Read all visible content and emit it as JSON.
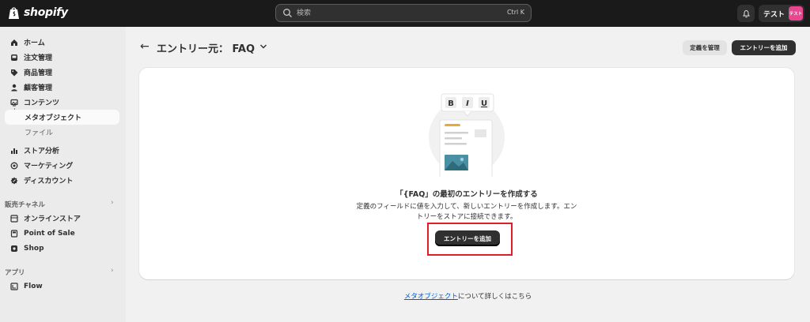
{
  "topbar": {
    "brand": "shopify",
    "search_placeholder": "検索",
    "search_shortcut": "Ctrl K",
    "user_name": "テスト",
    "avatar_text": "テスト"
  },
  "sidebar": {
    "items": [
      {
        "label": "ホーム",
        "icon": "home-icon"
      },
      {
        "label": "注文管理",
        "icon": "inbox-icon"
      },
      {
        "label": "商品管理",
        "icon": "tag-icon"
      },
      {
        "label": "顧客管理",
        "icon": "person-icon"
      },
      {
        "label": "コンテンツ",
        "icon": "image-icon"
      },
      {
        "label": "メタオブジェクト",
        "icon": ""
      },
      {
        "label": "ファイル",
        "icon": ""
      },
      {
        "label": "ストア分析",
        "icon": "bar-chart-icon"
      },
      {
        "label": "マーケティング",
        "icon": "target-icon"
      },
      {
        "label": "ディスカウント",
        "icon": "discount-icon"
      }
    ],
    "sales_channels_label": "販売チャネル",
    "channels": [
      {
        "label": "オンラインストア",
        "icon": "store-icon"
      },
      {
        "label": "Point of Sale",
        "icon": "pos-icon"
      },
      {
        "label": "Shop",
        "icon": "shop-icon"
      }
    ],
    "apps_label": "アプリ",
    "apps": [
      {
        "label": "Flow",
        "icon": "flow-icon"
      }
    ]
  },
  "header": {
    "title": "エントリー元： FAQ",
    "manage_definition": "定義を管理",
    "add_entry": "エントリーを追加"
  },
  "empty_state": {
    "illustration_buttons": [
      "B",
      "I",
      "U"
    ],
    "heading": "「{FAQ」の最初のエントリーを作成する",
    "description": "定義のフィールドに値を入力して、新しいエントリーを作成します。エントリーをストアに接続できます。",
    "cta": "エントリーを追加"
  },
  "footer": {
    "link_text": "メタオブジェクト",
    "suffix": "について詳しくはこちら"
  }
}
